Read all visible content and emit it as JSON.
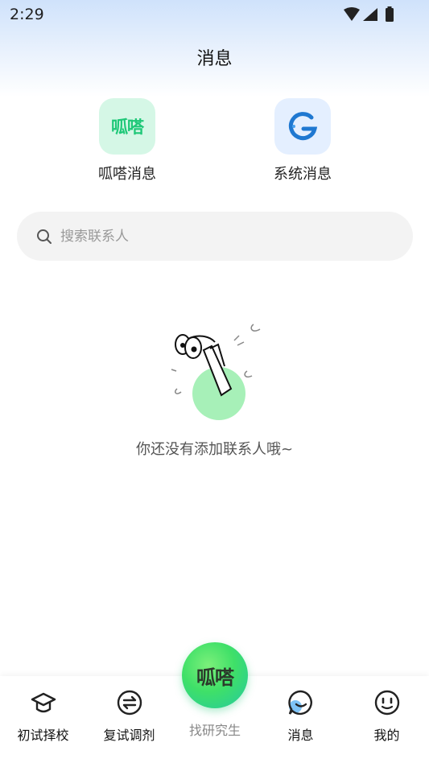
{
  "status_bar": {
    "time": "2:29"
  },
  "header": {
    "title": "消息"
  },
  "quick_entries": [
    {
      "label": "呱嗒消息",
      "logo_text": "呱嗒"
    },
    {
      "label": "系统消息"
    }
  ],
  "search": {
    "placeholder": "搜索联系人"
  },
  "empty_state": {
    "text": "你还没有添加联系人哦~"
  },
  "tabbar": {
    "items": [
      {
        "label": "初试择校",
        "icon": "graduation-cap-icon"
      },
      {
        "label": "复试调剂",
        "icon": "swap-icon"
      },
      {
        "label": "找研究生",
        "icon": "center-logo",
        "logo_text": "呱嗒"
      },
      {
        "label": "消息",
        "icon": "chat-bubble-icon"
      },
      {
        "label": "我的",
        "icon": "smile-face-icon"
      }
    ]
  },
  "colors": {
    "accent_green": "#2fd36f",
    "brand_blue": "#1f78d1"
  }
}
